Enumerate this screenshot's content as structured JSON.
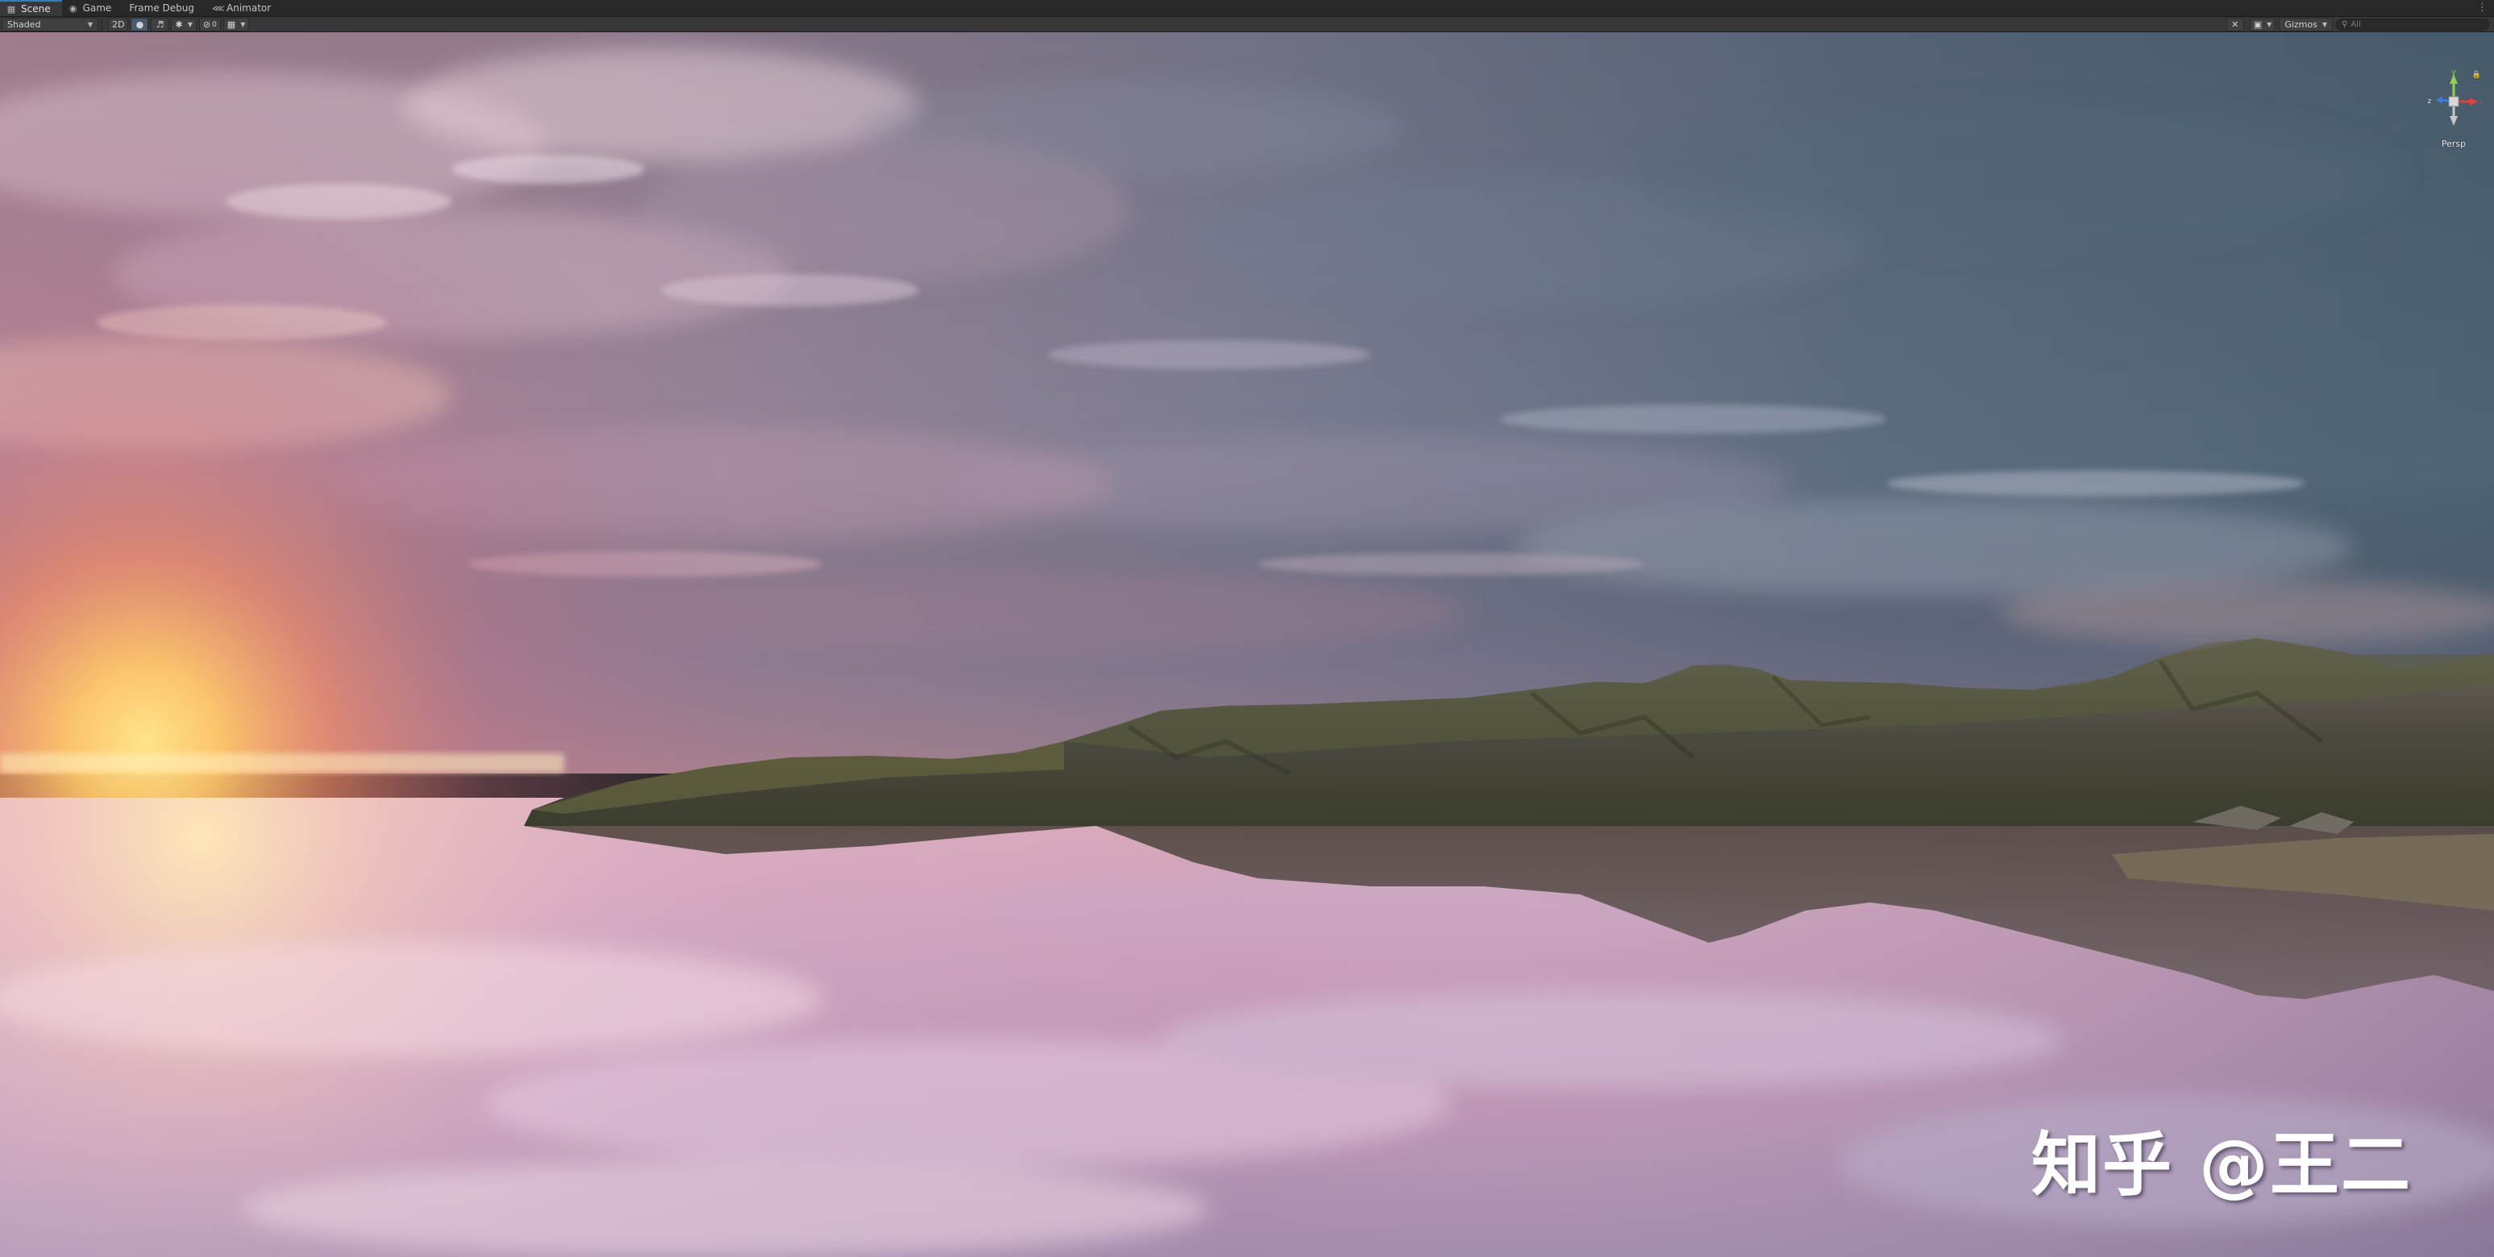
{
  "tabs": [
    {
      "label": "Scene",
      "icon": "scene-icon",
      "active": true
    },
    {
      "label": "Game",
      "icon": "game-controller-icon",
      "active": false
    },
    {
      "label": "Frame Debug",
      "icon": "",
      "active": false
    },
    {
      "label": "Animator",
      "icon": "animator-icon",
      "active": false
    }
  ],
  "toolbar": {
    "shading_mode": "Shaded",
    "mode_2d_label": "2D",
    "gizmos_label": "Gizmos",
    "search_placeholder": "All"
  },
  "gizmo": {
    "projection": "Persp",
    "axis_y": "y",
    "axis_z": "z",
    "axis_x": "x"
  },
  "watermark": {
    "text": "知乎 @王二"
  },
  "colors": {
    "active_tab_accent": "#3a79bb",
    "toolbar_bg": "#383838",
    "tabbar_bg": "#282828",
    "gizmo_y": "#8fd14f",
    "gizmo_x": "#e0413c",
    "gizmo_z": "#3d7be0"
  }
}
